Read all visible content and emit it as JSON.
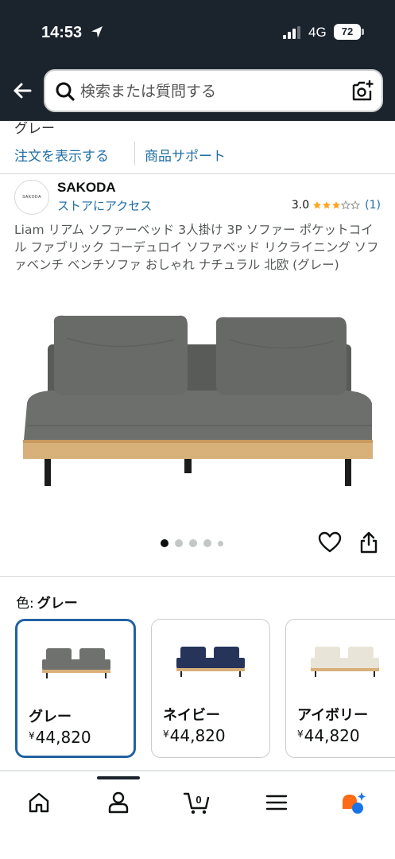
{
  "status_bar": {
    "time": "14:53",
    "network": "4G",
    "battery": "72"
  },
  "search": {
    "placeholder": "検索または質問する"
  },
  "order_strip": {
    "color_text_cut": "グレー",
    "view_order": "注文を表示する",
    "product_support": "商品サポート"
  },
  "brand": {
    "logo_text": "SAKODA",
    "name": "SAKODA",
    "store_link": "ストアにアクセス"
  },
  "rating": {
    "value": "3.0",
    "stars": 3,
    "count": "(1)"
  },
  "product": {
    "title": "Liam リアム ソファーベッド 3人掛け 3P ソファー ポケットコイル ファブリック コーデュロイ ソファベッド リクライニング ソファベンチ ベンチソファ おしゃれ ナチュラル 北欧 (グレー)",
    "image_count": 5,
    "image_index": 1
  },
  "color_selector": {
    "label": "色:",
    "selected": "グレー",
    "variants": [
      {
        "name": "グレー",
        "currency": "¥",
        "price": "44,820",
        "color": "#6f716f"
      },
      {
        "name": "ネイビー",
        "currency": "¥",
        "price": "44,820",
        "color": "#26345a"
      },
      {
        "name": "アイボリー",
        "currency": "¥",
        "price": "44,820",
        "color": "#e9e4d8"
      }
    ]
  },
  "cart": {
    "count": "0"
  },
  "colors": {
    "header_bg": "#1b232d",
    "link": "#1f6ea5",
    "star": "#ffa41c",
    "selected_border": "#2162a1"
  },
  "bottom_nav": [
    "home-icon",
    "account-icon",
    "cart-icon",
    "menu-icon",
    "rufus-icon"
  ]
}
